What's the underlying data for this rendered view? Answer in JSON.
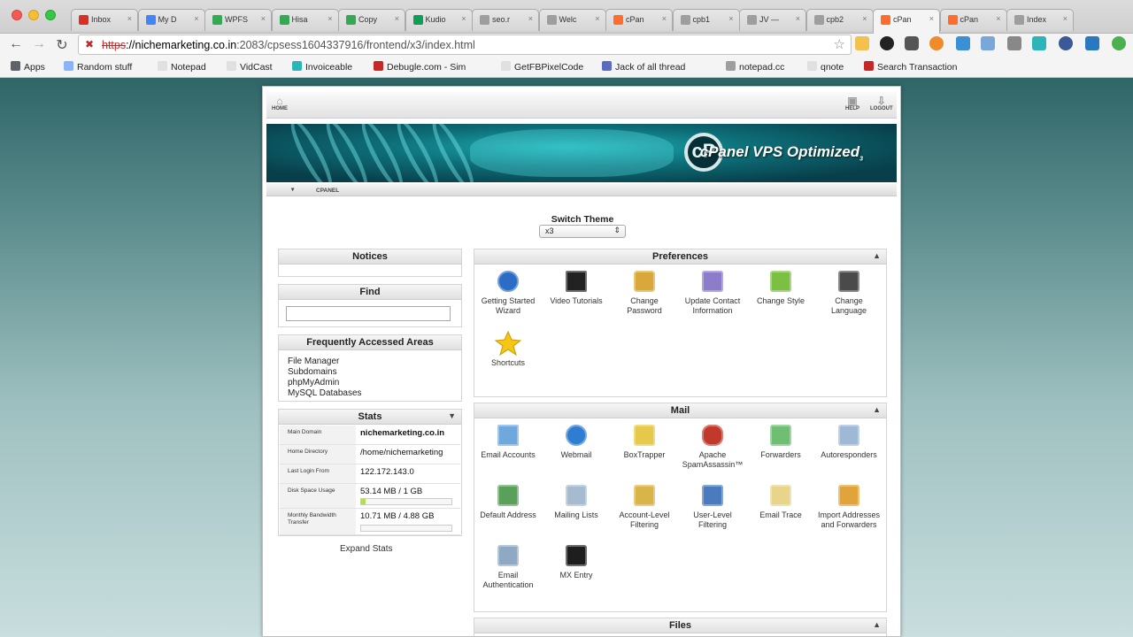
{
  "browser": {
    "tabs": [
      {
        "label": "Inbox",
        "color": "#d93025"
      },
      {
        "label": "My D",
        "color": "#4285f4"
      },
      {
        "label": "WPFS",
        "color": "#34a853"
      },
      {
        "label": "Hisa",
        "color": "#34a853"
      },
      {
        "label": "Copy",
        "color": "#34a853"
      },
      {
        "label": "Kudio",
        "color": "#0f9d58"
      },
      {
        "label": "seo.r",
        "color": "#9e9e9e"
      },
      {
        "label": "Welc",
        "color": "#9e9e9e"
      },
      {
        "label": "cPan",
        "color": "#ff6c2c"
      },
      {
        "label": "cpb1",
        "color": "#9e9e9e"
      },
      {
        "label": "JV —",
        "color": "#9e9e9e"
      },
      {
        "label": "cpb2",
        "color": "#9e9e9e"
      },
      {
        "label": "cPan",
        "color": "#ff6c2c"
      },
      {
        "label": "cPan",
        "color": "#ff6c2c"
      },
      {
        "label": "Index",
        "color": "#9e9e9e"
      }
    ],
    "url": {
      "scheme": "https",
      "host": "://nichemarketing.co.in",
      "rest": ":2083/cpsess1604337916/frontend/x3/index.html"
    },
    "bookmarks": [
      {
        "label": "Apps",
        "color": "#5f6368"
      },
      {
        "label": "Random stuff",
        "color": "#8ab4f8"
      },
      {
        "label": "Notepad",
        "color": "#e0e0e0"
      },
      {
        "label": "VidCast",
        "color": "#e0e0e0"
      },
      {
        "label": "Invoiceable",
        "color": "#2bb5b8"
      },
      {
        "label": "Debugle.com - Sim",
        "color": "#c62828"
      },
      {
        "label": "GetFBPixelCode",
        "color": "#e0e0e0"
      },
      {
        "label": "Jack of all thread",
        "color": "#5c6bc0"
      },
      {
        "label": "notepad.cc",
        "color": "#9e9e9e"
      },
      {
        "label": "qnote",
        "color": "#e0e0e0"
      },
      {
        "label": "Search Transaction",
        "color": "#c62828"
      }
    ]
  },
  "cpanel": {
    "topbar": {
      "home": "HOME",
      "help": "HELP",
      "logout": "LOGOUT"
    },
    "banner": {
      "logo_text": "cPanel VPS Optimized",
      "logo_mark": "cP",
      "logo_suffix": "3"
    },
    "subnav": "CPANEL",
    "switch_theme": {
      "label": "Switch Theme",
      "value": "x3"
    },
    "notices": {
      "title": "Notices"
    },
    "find": {
      "title": "Find",
      "value": ""
    },
    "frequent": {
      "title": "Frequently Accessed Areas",
      "items": [
        "File Manager",
        "Subdomains",
        "phpMyAdmin",
        "MySQL Databases"
      ]
    },
    "stats": {
      "title": "Stats",
      "rows": [
        {
          "key": "Main Domain",
          "value": "nichemarketing.co.in",
          "bold": true
        },
        {
          "key": "Home Directory",
          "value": "/home/nichemarketing"
        },
        {
          "key": "Last Login From",
          "value": "122.172.143.0"
        },
        {
          "key": "Disk Space Usage",
          "value": "53.14 MB / 1 GB",
          "fill": 0.052
        },
        {
          "key": "Monthly Bandwidth Transfer",
          "value": "10.71 MB / 4.88 GB",
          "fill": 0.002
        }
      ],
      "expand": "Expand Stats"
    },
    "preferences": {
      "title": "Preferences",
      "items": [
        {
          "label": "Getting Started Wizard",
          "icon": "wizard-icon"
        },
        {
          "label": "Video Tutorials",
          "icon": "clapperboard-icon"
        },
        {
          "label": "Change Password",
          "icon": "padlock-icon"
        },
        {
          "label": "Update Contact Information",
          "icon": "contact-book-icon"
        },
        {
          "label": "Change Style",
          "icon": "palette-icon"
        },
        {
          "label": "Change Language",
          "icon": "language-icon"
        },
        {
          "label": "Shortcuts",
          "icon": "star-icon"
        }
      ]
    },
    "mail": {
      "title": "Mail",
      "items": [
        {
          "label": "Email Accounts",
          "icon": "envelope-icon"
        },
        {
          "label": "Webmail",
          "icon": "globe-mail-icon"
        },
        {
          "label": "BoxTrapper",
          "icon": "mail-trap-icon"
        },
        {
          "label": "Apache SpamAssassin™",
          "icon": "spam-bug-icon"
        },
        {
          "label": "Forwarders",
          "icon": "forward-arrow-icon"
        },
        {
          "label": "Autoresponders",
          "icon": "autoresponder-icon"
        },
        {
          "label": "Default Address",
          "icon": "default-address-icon"
        },
        {
          "label": "Mailing Lists",
          "icon": "mailing-list-icon"
        },
        {
          "label": "Account-Level Filtering",
          "icon": "funnel-icon"
        },
        {
          "label": "User-Level Filtering",
          "icon": "user-funnel-icon"
        },
        {
          "label": "Email Trace",
          "icon": "trace-icon"
        },
        {
          "label": "Import Addresses and Forwarders",
          "icon": "import-icon"
        },
        {
          "label": "Email Authentication",
          "icon": "authentication-icon"
        },
        {
          "label": "MX Entry",
          "icon": "mx-entry-icon"
        }
      ]
    },
    "files": {
      "title": "Files"
    }
  }
}
